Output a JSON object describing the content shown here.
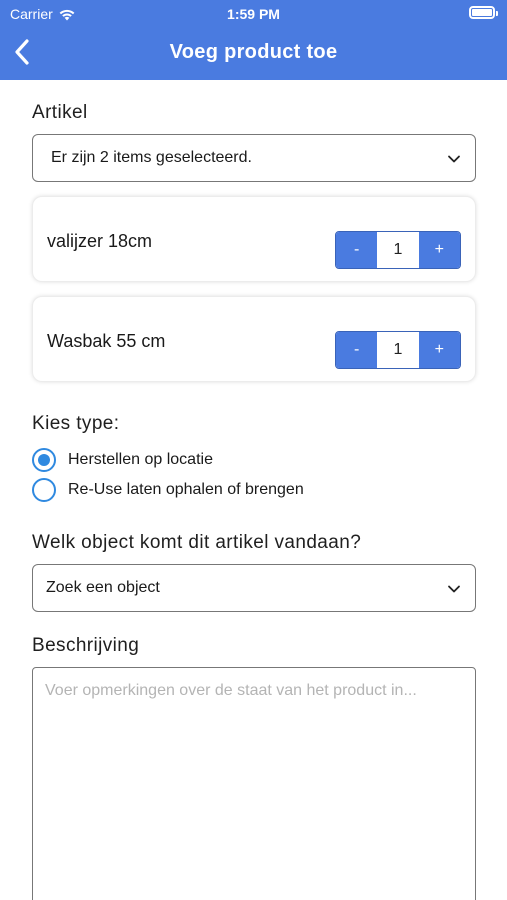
{
  "status_bar": {
    "carrier": "Carrier",
    "time": "1:59 PM"
  },
  "nav": {
    "title": "Voeg product toe"
  },
  "artikel": {
    "label": "Artikel",
    "select_value": "Er zijn 2 items geselecteerd.",
    "items": [
      {
        "name": "valijzer 18cm",
        "quantity": "1",
        "minus": "-",
        "plus": "+"
      },
      {
        "name": "Wasbak 55 cm",
        "quantity": "1",
        "minus": "-",
        "plus": "+"
      }
    ]
  },
  "type": {
    "label": "Kies type:",
    "options": [
      {
        "label": "Herstellen op locatie",
        "selected": true
      },
      {
        "label": "Re-Use laten ophalen of brengen",
        "selected": false
      }
    ]
  },
  "object": {
    "label": "Welk object komt dit artikel vandaan?",
    "select_value": "Zoek een object"
  },
  "beschrijving": {
    "label": "Beschrijving",
    "placeholder": "Voer opmerkingen over de staat van het product in..."
  },
  "colors": {
    "accent": "#4a7be0",
    "radio": "#2f89e0"
  }
}
